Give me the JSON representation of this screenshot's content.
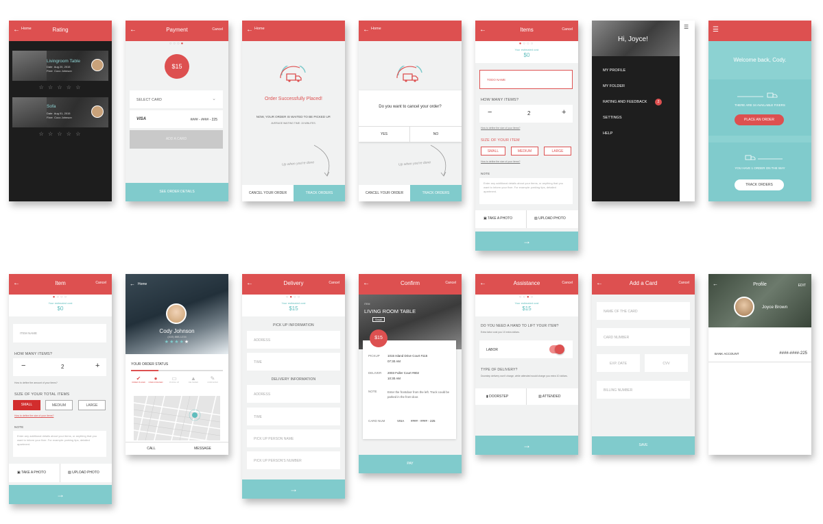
{
  "colors": {
    "accent": "#dd5050",
    "teal": "#80cbcc",
    "dark": "#222222"
  },
  "s1": {
    "back": "Home",
    "title": "Rating",
    "items": [
      {
        "name": "Livingroom Table",
        "date_label": "Date",
        "date": "Aug 20, 2015",
        "fixer_label": "Fixer",
        "fixer": "Coco Johnson"
      },
      {
        "name": "Sofa",
        "date_label": "Date",
        "date": "Aug 01, 2015",
        "fixer_label": "Fixer",
        "fixer": "Coco Johnson"
      }
    ],
    "stars": "☆ ☆ ☆ ☆ ☆"
  },
  "s2": {
    "title": "Payment",
    "cancel": "Cancel",
    "price": "$15",
    "select": "SELECT CARD",
    "card_brand": "VISA",
    "card_num": "#### - #### - 225",
    "add": "ADD A CARD",
    "footer": "SEE ORDER DETAILS"
  },
  "s3": {
    "back": "Home",
    "headline": "Order Successfully Placed!",
    "line1": "NOW, YOUR ORDER IS WAITED TO BE PICKED UP.",
    "line2": "AVERAGE WAITING TIME: 15 MINUTES.",
    "hint": "Up when you're done",
    "cancel": "CANCEL YOUR ORDER",
    "track": "TRACK ORDERS"
  },
  "s4": {
    "back": "Home",
    "question": "Do you want to cancel your order?",
    "yes": "YES",
    "no": "NO",
    "hint": "Up when you're done",
    "cancel": "CANCEL YOUR ORDER",
    "track": "TRACK ORDERS"
  },
  "s5": {
    "title": "Items",
    "cancel": "Cancel",
    "est_label": "Your estimated cost",
    "est": "$0",
    "name_ph": "TODO NAME",
    "how_many": "HOW MANY ITEMS?",
    "qty": "2",
    "minus": "−",
    "plus": "+",
    "define1": "How to define the size of your items?",
    "size_label": "SIZE OF YOUR ITEM",
    "small": "SMALL",
    "medium": "MEDIUM",
    "large": "LARGE",
    "define2": "How to define the size of your items?",
    "note": "NOTE",
    "note_ph": "Enter any additional details about your items, or anything that you want to inform your fixer. For example: parking tips, detailed apartment.",
    "take": "TAKE A PHOTO",
    "upload": "UPLOAD PHOTO"
  },
  "s6": {
    "greet": "Hi, Joyce!",
    "menu": [
      "MY PROFILE",
      "MY FOLDER",
      "RATING AND FEEDBACK",
      "SETTINGS",
      "HELP"
    ],
    "badge": "2"
  },
  "s7": {
    "welcome": "Welcome back, Cody.",
    "fixers": "THERE ARE  34  AVAILABLE FIXERS",
    "place": "PLACE AN ORDER",
    "orders": "YOU HAVE  1  ORDER ON THE WAY",
    "track": "TRACK ORDERS"
  },
  "s8": {
    "title": "Item",
    "cancel": "Cancel",
    "est_label": "Your estimated cost",
    "est": "$0",
    "name_ph": "ITEM NAME",
    "how_many": "HOW MANY ITEMS?",
    "qty": "2",
    "minus": "−",
    "plus": "+",
    "define1": "How to define the amount of your items?",
    "size_label": "SIZE OF YOUR TOTAL ITEMS",
    "small": "SMALL",
    "medium": "MEDIUM",
    "large": "LARGE",
    "define2": "How to define the size of your items?",
    "note": "NOTE",
    "note_ph": "Enter any additional details about your items, or anything that you want to inform your fixer. For example: parking tips, detailed apartment.",
    "take": "TAKE A PHOTO",
    "upload": "UPLOAD PHOTO"
  },
  "s9": {
    "back": "Home",
    "name": "Cody Johnson",
    "phone": "(415) 888-1234",
    "status": "YOUR ORDER STATUS",
    "steps": [
      "ORDER PLACED",
      "FIXER ASSIGNED",
      "PICKING UP",
      "DELIVERED",
      "COMPLETED"
    ],
    "call": "CALL",
    "message": "MESSAGE"
  },
  "s10": {
    "title": "Delivery",
    "cancel": "Cancel",
    "est_label": "Your estimated cost",
    "est": "$15",
    "pickup": "PICK UP INFORMATION",
    "address": "ADDRESS",
    "time": "TIME",
    "delivery": "DELIVERY INFORMATION",
    "address2": "ADDRESS",
    "time2": "TIME",
    "pname": "PICK UP PERSON NAME",
    "pnum": "PICK UP PERSON'S NUMBER"
  },
  "s11": {
    "title": "Confirm",
    "cancel": "Cancel",
    "item_label": "ITEM",
    "item": "LIVING ROOM TABLE",
    "size": "Small",
    "price": "$15",
    "pickup_label": "PICKUP",
    "pickup": "1015 Island Drive Court #115",
    "pickup_time": "07:30 AM",
    "deliver_label": "DELIVER",
    "deliver": "2003 Fuller Court #802",
    "deliver_time": "10:30 AM",
    "note_label": "NOTE",
    "note": "Enter the frontdoor from the left. Truck could be parked in the front door.",
    "card_label": "CARD NUM",
    "card_brand": "VISA",
    "card": "#### - #### - 225",
    "pay": "PAY"
  },
  "s12": {
    "title": "Assistance",
    "cancel": "Cancel",
    "est_label": "Your estimated cost",
    "est": "$15",
    "q1": "DO YOU NEED A HAND TO LIFT YOUR ITEM?",
    "q1_sub": "Extra labor cost you 10 extra dollars.",
    "labor": "LABOR",
    "q2": "TYPE OF DELIVERY?",
    "q2_sub": "Doorstep delivery won't charge, while attended would charge you extra 10 dollars.",
    "doorstep": "DOORSTEP",
    "attended": "ATTENDED"
  },
  "s13": {
    "title": "Add a Card",
    "cancel": "Cancel",
    "name": "NAME OF THE CARD",
    "number": "CARD NUMBER",
    "exp": "EXP. DATE",
    "cvv": "CVV",
    "billing": "BILLING NUMBER",
    "save": "SAVE"
  },
  "s14": {
    "title": "Profile",
    "edit": "EDIT",
    "name": "Joyce Brown",
    "bank_label": "BANK ACCOUNT",
    "bank": "####-####-225"
  }
}
